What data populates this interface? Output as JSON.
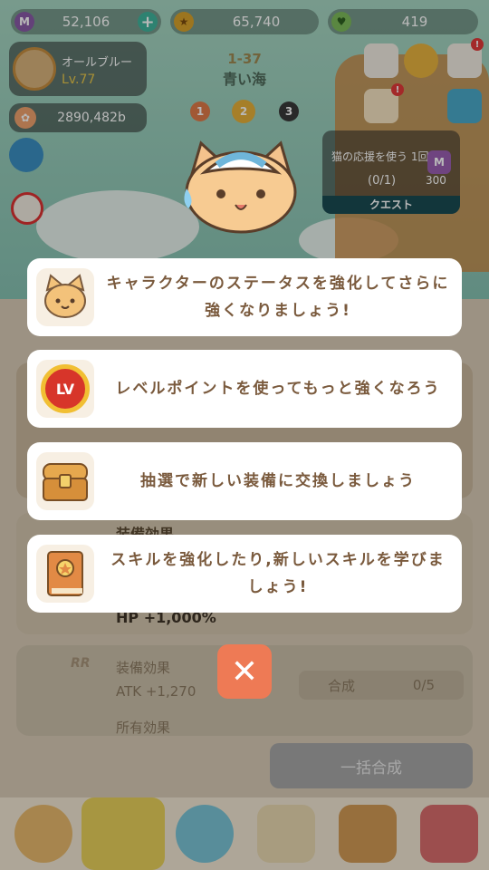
{
  "topbar": {
    "gems": "52,106",
    "gems_icon": "M",
    "coins": "65,740",
    "hearts": "419"
  },
  "profile": {
    "name": "オールブルー",
    "level": "Lv.77",
    "paws": "2890,482b"
  },
  "stage": {
    "number": "1-37",
    "title": "青い海",
    "dots": [
      "1",
      "2",
      "3"
    ]
  },
  "quest": {
    "title": "猫の応援を使う 1回",
    "progress": "(0/1)",
    "reward_icon": "M",
    "reward_value": "300",
    "button_label": "クエスト"
  },
  "tips": [
    {
      "icon": "cat-face-icon",
      "text": "キャラクターのステータスを強化してさらに強くなりましょう!"
    },
    {
      "icon": "level-point-icon",
      "icon_label": "LV",
      "text": "レベルポイントを使ってもっと強くなろう"
    },
    {
      "icon": "treasure-chest-icon",
      "text": "抽選で新しい装備に交換しましょう"
    },
    {
      "icon": "skill-book-icon",
      "text": "スキルを強化したり,新しいスキルを学びましょう!"
    }
  ],
  "background": {
    "equip_effect": "装備効果",
    "hp_bonus": "HP +1,000%",
    "atk_bonus": "ATK +1,270",
    "rarity": "RR",
    "owned_effect": "所有効果",
    "merge_label": "合成",
    "merge_count": "0/5",
    "bulk_merge": "一括合成"
  },
  "colors": {
    "accent": "#ee7a55",
    "text_brown": "#7a5a3d",
    "quest_bar": "#1a4b52"
  }
}
